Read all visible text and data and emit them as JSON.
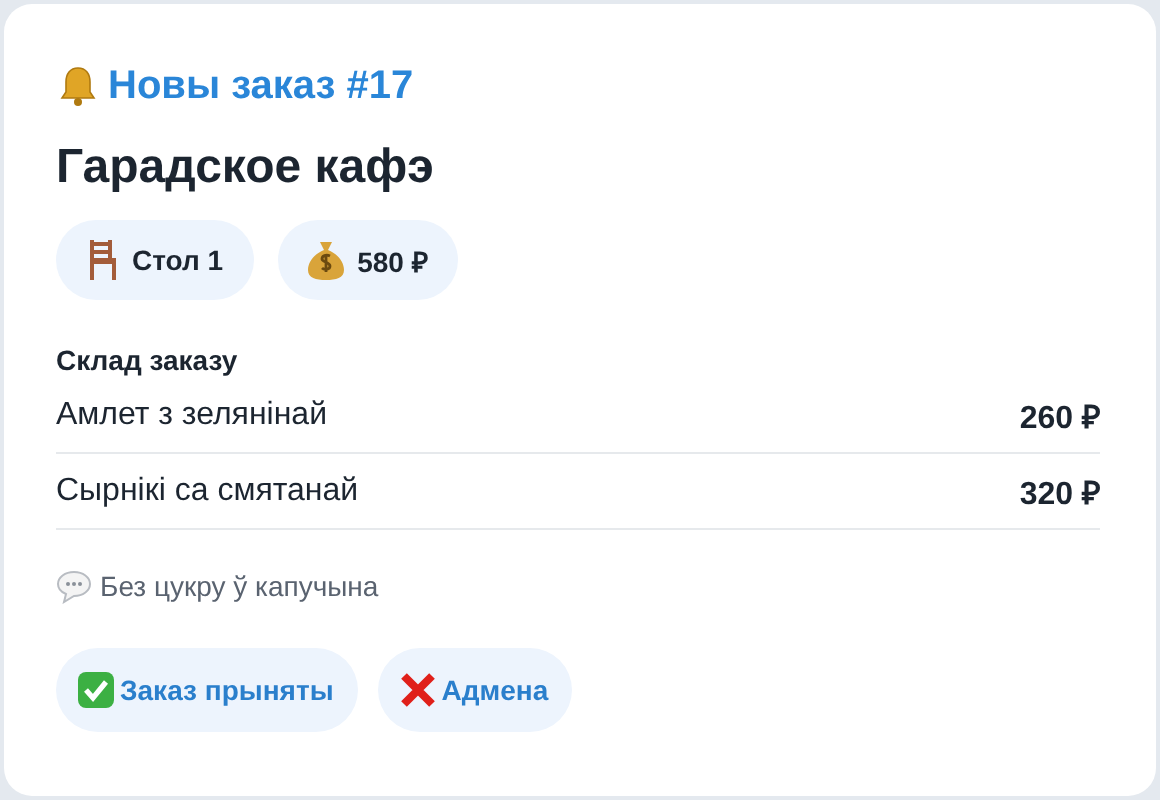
{
  "header": {
    "title": "Новы заказ #17"
  },
  "venue": "Гарадское кафэ",
  "chips": [
    {
      "kind": "chair",
      "label": "Стол 1"
    },
    {
      "kind": "money",
      "label": "580 ₽"
    }
  ],
  "order": {
    "heading": "Склад заказу",
    "items": [
      {
        "name": "Амлет з зелянінай",
        "price": "260 ₽"
      },
      {
        "name": "Сырнікі са смятанай",
        "price": "320 ₽"
      }
    ]
  },
  "note": "Без цукру ў капучына",
  "buttons": [
    {
      "kind": "accept",
      "label": "Заказ прыняты"
    },
    {
      "kind": "cancel",
      "label": "Адмена"
    }
  ]
}
